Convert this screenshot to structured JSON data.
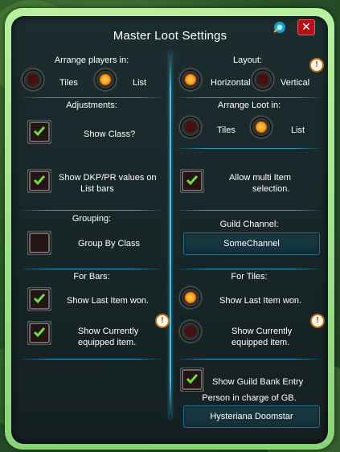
{
  "window": {
    "title": "Master Loot Settings",
    "close_label": "✕"
  },
  "left": {
    "arrange_players": {
      "heading": "Arrange players in:",
      "options": [
        {
          "label": "Tiles",
          "selected": false
        },
        {
          "label": "List",
          "selected": true
        }
      ]
    },
    "adjustments": {
      "heading": "Adjustments:",
      "items": [
        {
          "label": "Show Class?",
          "checked": true
        },
        {
          "label_line1": "Show DKP/PR values on",
          "label_line2": "List bars",
          "checked": true
        }
      ]
    },
    "grouping": {
      "heading": "Grouping:",
      "items": [
        {
          "label": "Group By Class",
          "checked": false
        }
      ]
    },
    "for_bars": {
      "heading": "For Bars:",
      "items": [
        {
          "label": "Show Last Item won.",
          "checked": true
        },
        {
          "label_line1": "Show Currently",
          "label_line2": "equipped item.",
          "checked": true
        }
      ]
    }
  },
  "right": {
    "layout": {
      "heading": "Layout:",
      "options": [
        {
          "label": "Horizontal",
          "selected": true
        },
        {
          "label": "Vertical",
          "selected": false
        }
      ]
    },
    "arrange_loot": {
      "heading": "Arrange Loot in:",
      "options": [
        {
          "label": "Tiles",
          "selected": false
        },
        {
          "label": "List",
          "selected": true
        }
      ]
    },
    "multi_item": {
      "label_line1": "Allow multi Item",
      "label_line2": "selection.",
      "checked": true
    },
    "guild_channel": {
      "heading": "Guild Channel:",
      "value": "SomeChannel"
    },
    "for_tiles": {
      "heading": "For Tiles:",
      "items": [
        {
          "label": "Show Last Item won.",
          "selected": true
        },
        {
          "label_line1": "Show Currently",
          "label_line2": "equipped item.",
          "selected": false
        }
      ]
    },
    "guild_bank": {
      "label": "Show Guild Bank Entry",
      "checked": true,
      "person_heading": "Person in charge of GB.",
      "person_value": "Hysteriana Doomstar"
    }
  },
  "info_glyph": "!"
}
